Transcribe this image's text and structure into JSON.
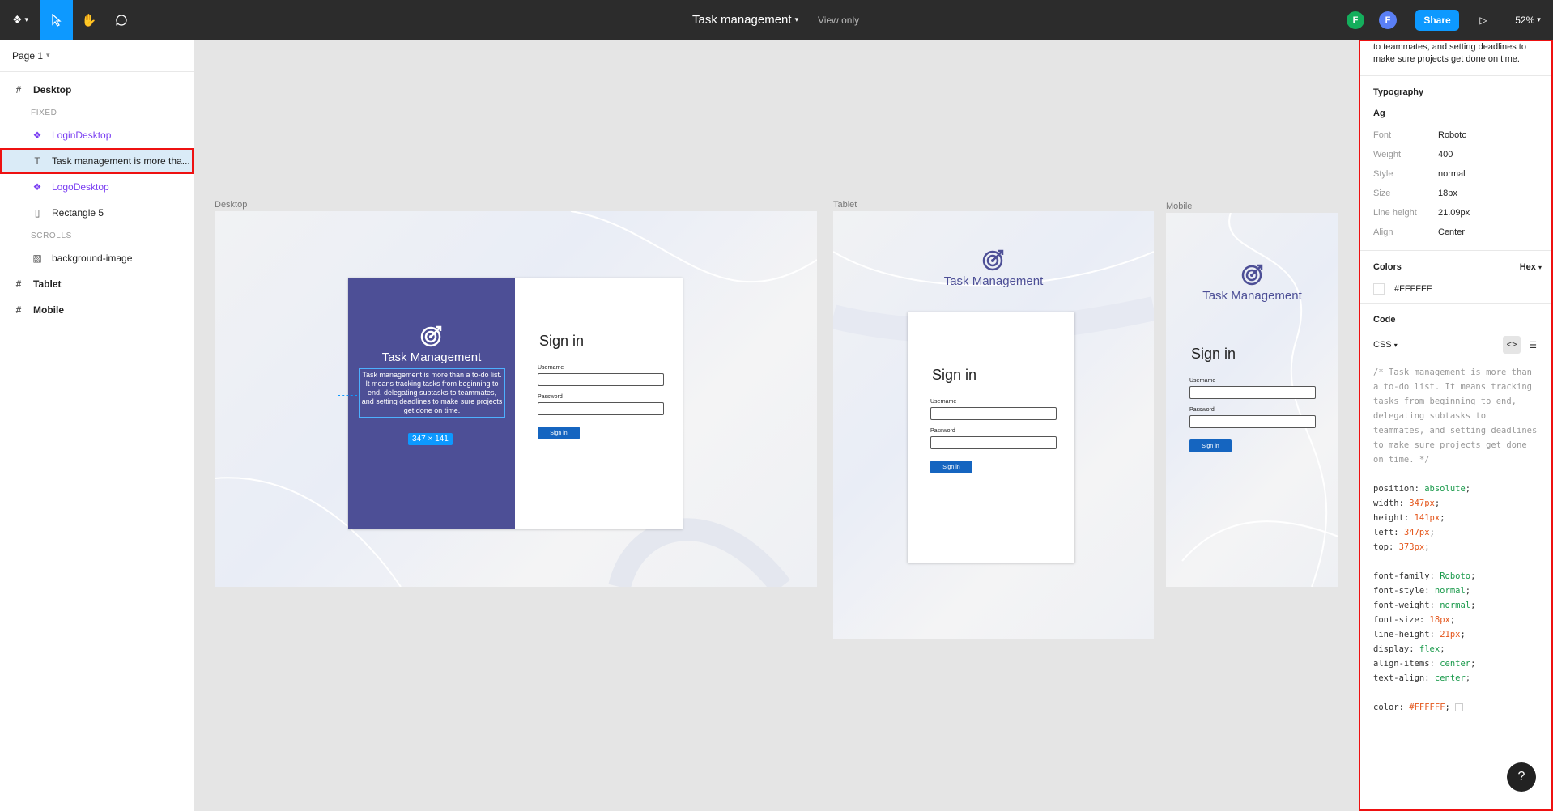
{
  "app": {
    "file_title": "Task management",
    "view_only": "View only",
    "avatars": [
      "F",
      "F"
    ],
    "share_label": "Share",
    "zoom": "52%",
    "accent_color": "#0d99ff"
  },
  "left_panel": {
    "page": "Page 1",
    "layers": {
      "desktop": "Desktop",
      "fixed_section": "FIXED",
      "login_desktop": "LoginDesktop",
      "task_text": "Task management is more tha...",
      "logo_desktop": "LogoDesktop",
      "rectangle": "Rectangle 5",
      "scrolls_section": "SCROLLS",
      "background_image": "background-image",
      "tablet": "Tablet",
      "mobile": "Mobile"
    }
  },
  "canvas": {
    "desktop": {
      "label": "Desktop",
      "brand": "Task Management",
      "description": "Task management is more than a to-do list. It means tracking tasks from beginning to end, delegating subtasks to teammates, and setting deadlines to make sure projects get done on time.",
      "dimension_badge": "347 × 141",
      "signin_title": "Sign in",
      "username_label": "Username",
      "password_label": "Password",
      "signin_button": "Sign in"
    },
    "tablet": {
      "label": "Tablet",
      "brand": "Task Management",
      "signin_title": "Sign in",
      "username_label": "Username",
      "password_label": "Password",
      "signin_button": "Sign in"
    },
    "mobile": {
      "label": "Mobile",
      "brand": "Task Management",
      "signin_title": "Sign in",
      "username_label": "Username",
      "password_label": "Password",
      "signin_button": "Sign in"
    }
  },
  "right_panel": {
    "top_text": "to teammates, and setting deadlines to make sure projects get done on time.",
    "typography": {
      "heading": "Typography",
      "sample": "Ag",
      "font_key": "Font",
      "font_val": "Roboto",
      "weight_key": "Weight",
      "weight_val": "400",
      "style_key": "Style",
      "style_val": "normal",
      "size_key": "Size",
      "size_val": "18px",
      "line_height_key": "Line height",
      "line_height_val": "21.09px",
      "align_key": "Align",
      "align_val": "Center"
    },
    "colors": {
      "heading": "Colors",
      "format": "Hex",
      "value": "#FFFFFF"
    },
    "code": {
      "heading": "Code",
      "language": "CSS",
      "comment": "/* Task management is more than a to-do list. It means tracking tasks from beginning to end, delegating subtasks to teammates, and setting deadlines to make sure projects get done on time. */",
      "lines": [
        {
          "prop": "position",
          "val": "absolute",
          "kind": "str"
        },
        {
          "prop": "width",
          "val": "347px",
          "kind": "num"
        },
        {
          "prop": "height",
          "val": "141px",
          "kind": "num"
        },
        {
          "prop": "left",
          "val": "347px",
          "kind": "num"
        },
        {
          "prop": "top",
          "val": "373px",
          "kind": "num"
        }
      ],
      "font_lines": [
        {
          "prop": "font-family",
          "val": "Roboto",
          "kind": "str"
        },
        {
          "prop": "font-style",
          "val": "normal",
          "kind": "str"
        },
        {
          "prop": "font-weight",
          "val": "normal",
          "kind": "str"
        },
        {
          "prop": "font-size",
          "val": "18px",
          "kind": "num"
        },
        {
          "prop": "line-height",
          "val": "21px",
          "kind": "num"
        },
        {
          "prop": "display",
          "val": "flex",
          "kind": "str"
        },
        {
          "prop": "align-items",
          "val": "center",
          "kind": "str"
        },
        {
          "prop": "text-align",
          "val": "center",
          "kind": "str"
        }
      ],
      "color_line": {
        "prop": "color",
        "val": "#FFFFFF",
        "kind": "num"
      }
    },
    "help": "?"
  }
}
